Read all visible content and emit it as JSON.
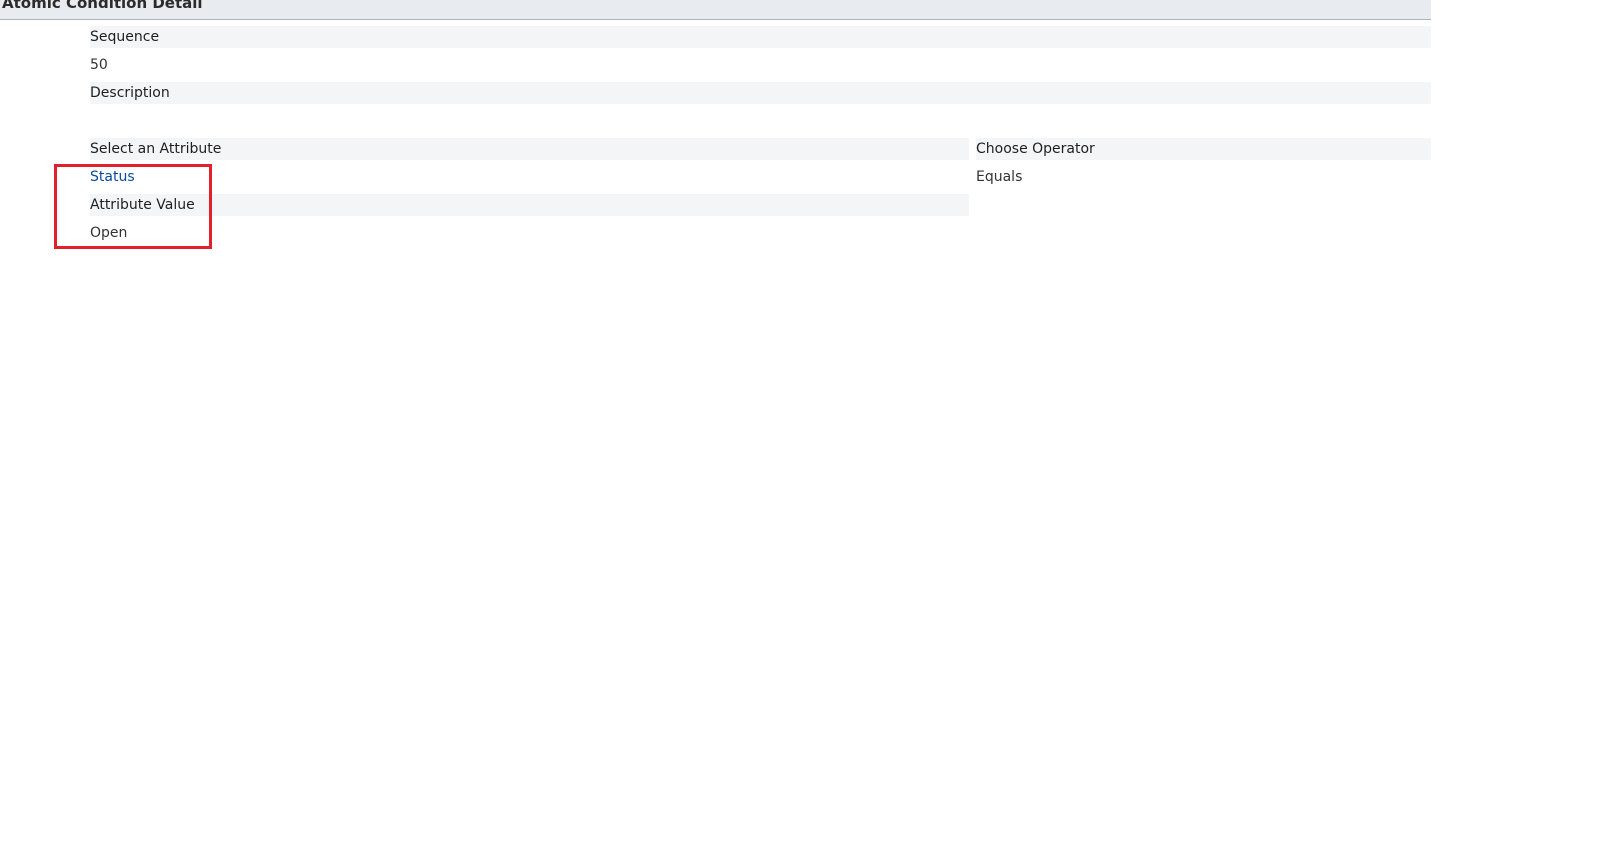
{
  "section": {
    "title": "Atomic Condition Detail"
  },
  "form": {
    "sequence": {
      "label": "Sequence",
      "value": "50"
    },
    "description": {
      "label": "Description",
      "value": ""
    },
    "attribute": {
      "label": "Select an Attribute",
      "value": "Status"
    },
    "operator": {
      "label": "Choose Operator",
      "value": "Equals"
    },
    "attribute_value": {
      "label": "Attribute Value",
      "value": "Open"
    }
  },
  "colors": {
    "highlight": "#e0202a",
    "link": "#0a4a9e",
    "header_bg": "#e8ecf0",
    "label_bg": "#f4f5f6"
  }
}
